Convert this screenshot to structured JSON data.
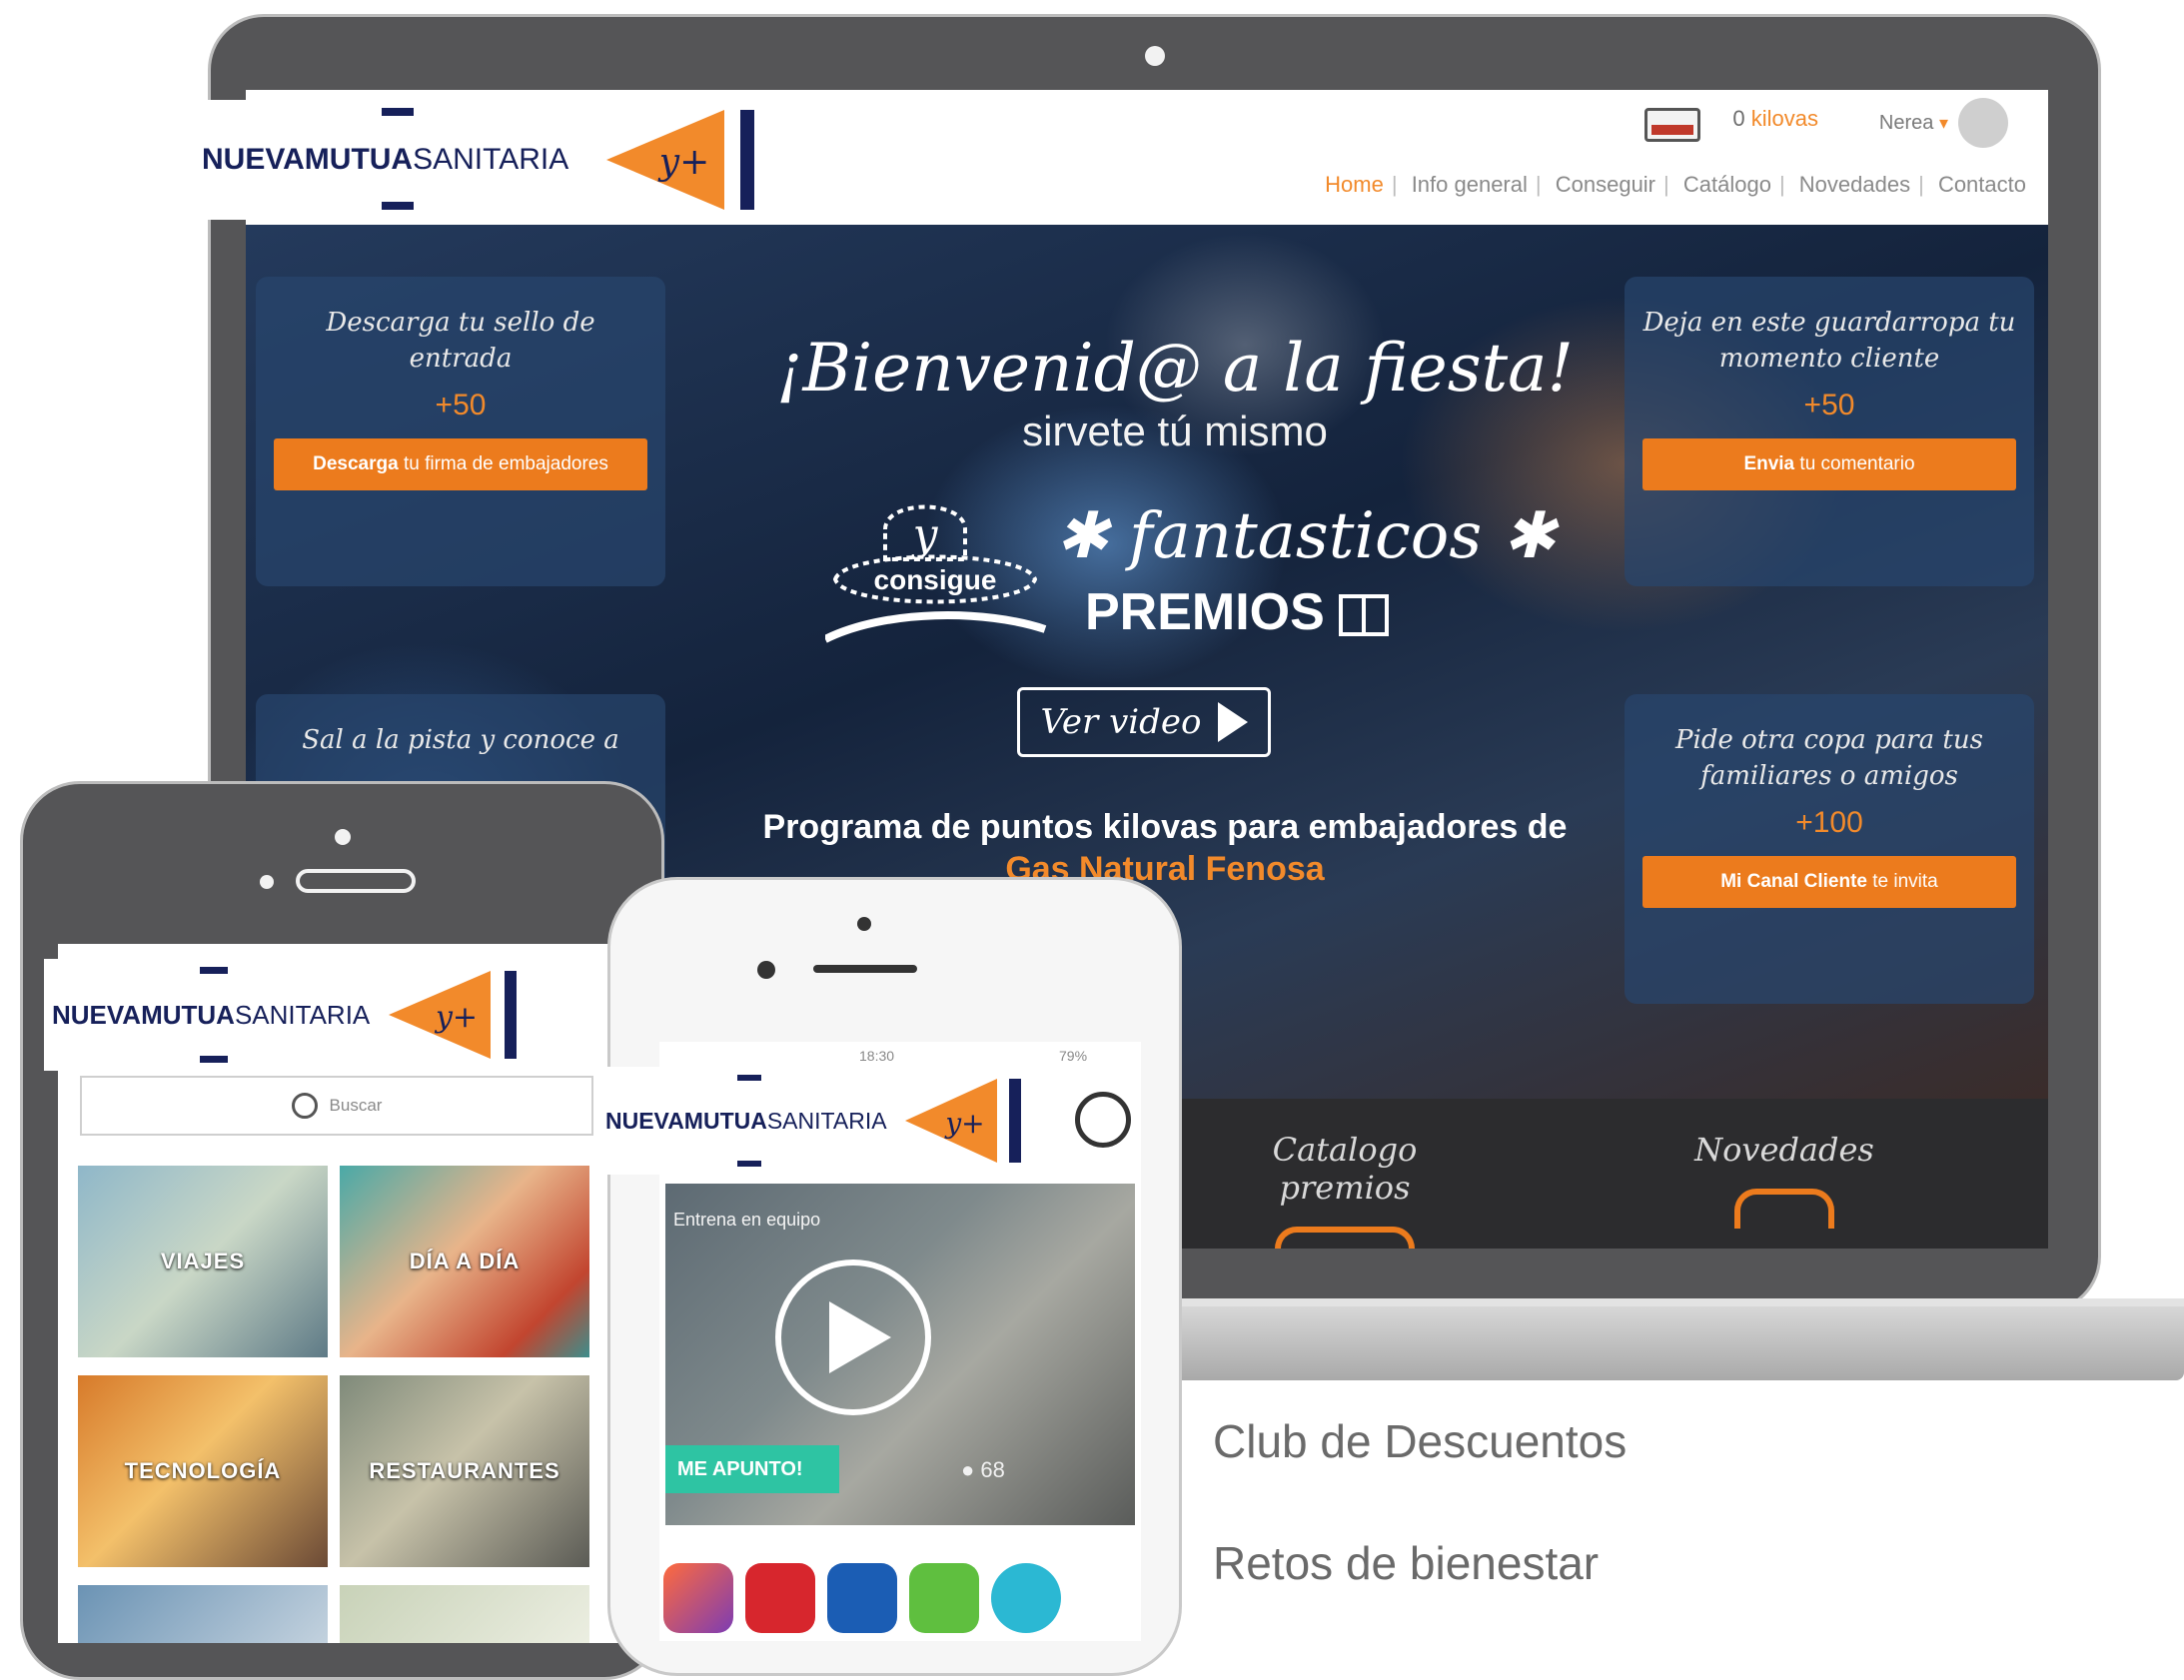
{
  "brand": {
    "name_bold": "NUEVAMUTUA",
    "name_light": "SANITARIA",
    "mark": "y+",
    "colors": {
      "navy": "#16205a",
      "orange": "#f28a2b"
    }
  },
  "laptop_site": {
    "header": {
      "points_value": "0",
      "points_unit": "kilovas",
      "user_name": "Nerea",
      "nav": [
        "Home",
        "Info general",
        "Conseguir",
        "Catálogo",
        "Novedades",
        "Contacto"
      ]
    },
    "hero": {
      "title": "¡Bienvenid@ a la fiesta!",
      "subtitle": "sirvete tú mismo",
      "y_badge": "y",
      "consigue": "consigue",
      "fantasticos": "fantasticos",
      "premios": "PREMIOS",
      "video_button": "Ver video",
      "program_line1": "Programa de puntos kilovas para embajadores de",
      "program_line2": "Gas Natural Fenosa"
    },
    "cards": {
      "left_top": {
        "text": "Descarga tu sello de entrada",
        "points": "+50",
        "cta_bold": "Descarga",
        "cta_rest": "tu firma de embajadores"
      },
      "left_bottom": {
        "text": "Sal a la pista y conoce a"
      },
      "right_top": {
        "text": "Deja en este guardarropa tu momento cliente",
        "points": "+50",
        "cta_bold": "Envia",
        "cta_rest": "tu comentario"
      },
      "right_bottom": {
        "text": "Pide otra copa para tus familiares o amigos",
        "points": "+100",
        "cta_bold": "Mi Canal Cliente",
        "cta_rest": "te invita"
      }
    },
    "bottom_links": [
      "Catalogo premios",
      "Novedades"
    ]
  },
  "phone_left": {
    "search_placeholder": "Buscar",
    "tiles": [
      "VIAJES",
      "DÍA A DÍA",
      "TECNOLOGÍA",
      "RESTAURANTES"
    ]
  },
  "phone_right": {
    "status_time": "18:30",
    "status_battery": "79%",
    "video_caption": "Entrena en equipo",
    "join_button": "ME APUNTO!",
    "participants": "68"
  },
  "features": [
    "Club de Descuentos",
    "Retos de bienestar"
  ]
}
